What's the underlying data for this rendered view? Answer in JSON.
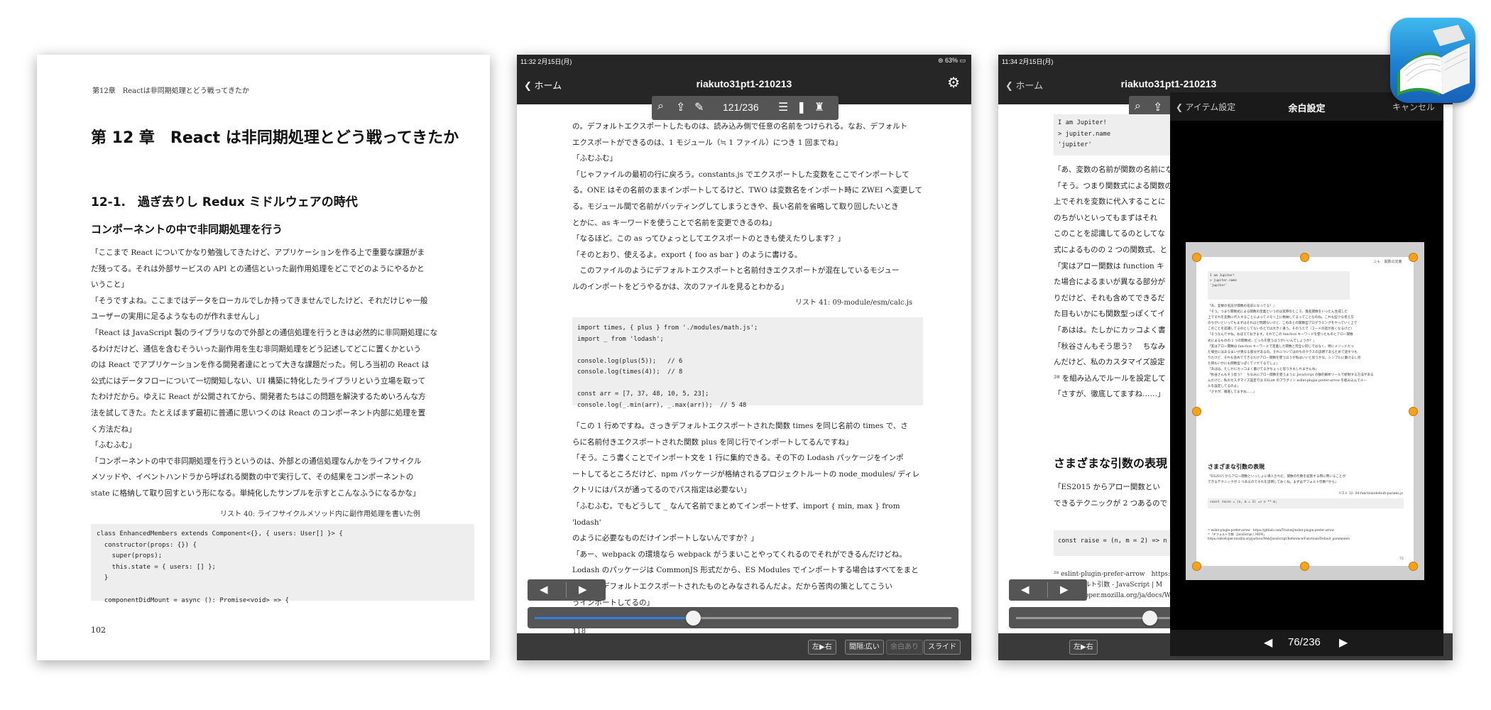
{
  "panel1": {
    "running_header": "第12章　Reactは非同期処理とどう戦ってきたか",
    "chapter_title": "第 12 章　React は非同期処理とどう戦ってきたか",
    "section_title": "12-1.　過ぎ去りし Redux ミドルウェアの時代",
    "subsection_title": "コンポーネントの中で非同期処理を行う",
    "paragraphs": [
      "「ここまで React についてかなり勉強してきたけど、アプリケーションを作る上で重要な課題がま",
      "だ残ってる。それは外部サービスの API との通信といった副作用処理をどこでどのようにやるかと",
      "いうこと」",
      "「そうですよね。ここまではデータをローカルでしか持ってきませんでしたけど、それだけじゃ一般",
      "ユーザーの実用に足るようなものが作れませんし」",
      "「React は JavaScript 製のライブラリなので外部との通信処理を行うときは必然的に非同期処理にな",
      "るわけだけど、通信を含むそういった副作用を生む非同期処理をどう記述してどこに置くかという",
      "のは React でアプリケーションを作る開発者達にとって大きな課題だった。何しろ当初の React は",
      "公式にはデータフローについて一切関知しない、UI 構築に特化したライブラリという立場を取って",
      "たわけだから。ゆえに React が公開されてから、開発者たちはこの問題を解決するためいろんな方",
      "法を試してきた。たとえばまず最初に普通に思いつくのは React のコンポーネント内部に処理を置",
      "く方法だね」",
      "「ふむふむ」",
      "「コンポーネントの中で非同期処理を行うというのは、外部との通信処理なんかをライフサイクル",
      "メソッドや、イベントハンドラから呼ばれる関数の中で実行して、その結果をコンポーネントの",
      "state に格納して取り回すという形になる。単純化したサンプルを示すとこんなふうになるかな」"
    ],
    "listing_caption": "リスト 40: ライフサイクルメソッド内に副作用処理を書いた例",
    "code": "class EnhancedMembers extends Component<{}, { users: User[] }> {\n  constructor(props: {}) {\n    super(props);\n    this.state = { users: [] };\n  }\n\n  componentDidMount = async (): Promise<void> => {",
    "page_number": "102"
  },
  "panel2": {
    "status_time": "11:32  2月15日(月)",
    "status_right": "⊜ 63% ▭",
    "nav_back": "ホーム",
    "nav_title": "riakuto31pt1-210213",
    "toolbar_page": "121/236",
    "paragraphs_top": [
      "の。デフォルトエクスポートしたものは、読み込み側で任意の名前をつけられる。なお、デフォルト",
      "エクスポートができるのは、1 モジュール（≒ 1 ファイル）につき 1 回までね」",
      "「ふむふむ」",
      "「じゃファイルの最初の行に戻ろう。constants.js でエクスポートした変数をここでインポートして",
      "る。ONE はその名前のままインポートしてるけど、TWO は変数名をインポート時に ZWEI へ変更して",
      "る。モジュール間で名前がバッティングしてしまうときや、長い名前を省略して取り回したいとき",
      "とかに、as キーワードを使うことで名前を変更できるのね」",
      "「なるほど。この as ってひょっとしてエクスポートのときも使えたりします？」",
      "「そのとおり、使えるよ。export { foo as bar } のように書ける。",
      "　このファイルのようにデフォルトエクスポートと名前付きエクスポートが混在しているモジュー",
      "ルのインポートをどうやるかは、次のファイルを見るとわかる」"
    ],
    "listing_caption": "リスト 41: 09-module/esm/calc.js",
    "code": "import times, { plus } from './modules/math.js';\nimport _ from 'lodash';\n\nconsole.log(plus(5));   // 6\nconsole.log(times(4));  // 8\n\nconst arr = [7, 37, 48, 10, 5, 23];\nconsole.log(_.min(arr), _.max(arr));  // 5 48",
    "paragraphs_bottom": [
      "「この 1 行めですね。さっきデフォルトエクスポートされた関数 times を同じ名前の times で、さ",
      "らに名前付きエクスポートされた関数 plus を同じ行でインポートしてるんですね」",
      "「そう。こう書くことでインポート文を 1 行に集約できる。その下の Lodash パッケージをインポ",
      "ートしてるところだけど、npm パッケージが格納されるプロジェクトルートの node_modules/ ディレ",
      "クトリにはパスが通ってるのでパス指定は必要ない」",
      "「ふむふむ。でもどうして _ なんて名前でまとめてインポートせず、import { min, max } from 'lodash'",
      "のように必要なものだけインポートしないんですか？」",
      "「あー、webpack の環境なら webpack がうまいことやってくれるのでそれができるんだけどね。",
      "Lodash のパッケージは CommonJS 形式だから、ES Modules でインポートする場合はすべてをまと",
      "めた形でデフォルトエクスポートされたものとみなされるんだよ。だから苦肉の策としてこうい",
      "うインポートしてるの」"
    ],
    "page_number": "118",
    "slider_progress": 0.38,
    "bottom_buttons": [
      "左▶右",
      "間隔:広い",
      "余白あり",
      "スライド"
    ]
  },
  "panel3": {
    "status_time": "11:34  2月15日(月)",
    "nav_back": "ホーム",
    "nav_title": "riakuto31pt1-210213",
    "code_top": "I am Jupiter!\n> jupiter.name\n'jupiter'",
    "paragraphs": [
      "「あ、変数の名前が関数の名前になってる！」",
      "「そう。つまり関数式による関数の",
      "上でそれを変数に代入することに",
      "のちがいといってもまずはそれ",
      "このことを認識してるのとしてな",
      "式によるものの 2 つの関数式、と",
      "「実はアロー関数は function キ",
      "た場合によるまいが異なる部分が",
      "りだけど、それも含めてできるだ",
      "た目もいかにも関数型っぽくてイ",
      "「あはは。たしかにカッコよく書",
      "「秋谷さんもそう思う？　ちなみ",
      "んだけど、私のカスタマイズ設定",
      "²⁸ を組み込んでルールを設定して",
      "「さすが、徹底してますね……」"
    ],
    "heading": "さまざまな引数の表現",
    "paragraphs2": [
      "「ES2015 からアロー関数とい",
      "できるテクニックが 2 つあるので"
    ],
    "code_b": "const raise = (n, m = 2) => n ** m;",
    "footnotes": [
      "²⁸ eslint-plugin-prefer-arrow　https://",
      "²⁹「デフォルト引数 - JavaScript | M",
      "ps://developer.mozilla.org/ja/docs/We"
    ],
    "slider_progress": 0.32,
    "overlay": {
      "back": "アイテム設定",
      "title": "余白設定",
      "cancel": "キャンセル",
      "page": "76/236",
      "mini_header": "2-4.　関数の定義",
      "mini_code": "I am Jupiter!\n> jupiter.name\n'jupiter'",
      "mini_lines": [
        "「あ、変数の名前が関数の名前になってる！」",
        "「そう。つまり関数式による関数の定義というのは実際のところ、無名関数をいったん生成した",
        "上でそれを変数に代入することによってメモリ上に格納してるってことなのね。これも些少な考え方",
        "のちがいといってもまずはそれほど問題ないけど、このあとの関数型プログラミングをやっていく上で",
        "このことを認識してるのとしてないのとでは大きく違う。そのうえで（コードの話が長くなるけど）",
        "「そうなんですね。おぼえておきます。それでこの function キーワードを使ったものとアロー関数",
        "式によるものの 2 つの関数式、どっちを使うほうがいいんでしょうか？」",
        "「実はアロー関数は function キーワードで定義した関数と完全に同じではなく、特にメソッドだっ",
        "た場合にはあるまいが異なる部分があるの。それについてはのちのクラスの説明であらためて話すつも",
        "りだけど、それも含めてできるだけアロー関数を使うほうが私はいいと思うかな。シンプルに書けるし見",
        "た目もいかにも関数型っぽくてイケてるでしょ」",
        "「あはは。たしかにカッコよく書けてるかちょっと思うかもしれませんね」",
        "「秋谷さんもそう思う？　ちなみにアロー関数を使うように JavaScript の静的解析ツールで統制する方法がある",
        "んだけど、私のカスタマイズ設定では ESLint のプラグイン eslint-plugin-prefer-arrow を組み込んでルー",
        "ルを設定してるのよ」",
        "「さすが、徹底してますね……」"
      ],
      "mini_heading": "さまざまな引数の表現",
      "mini_lines2": [
        "「ES2015 からアロー関数といっしょに導入された、関数の引数を拡張する際に用いることが",
        "できるテクニックが 2 つあるのでそれを説明しておくね。まずはデフォルト引数²⁹から」"
      ],
      "mini_caption": "リスト 32: 04-function/default-params.js",
      "mini_codeb": "const raise = (n, m = 2) => n ** m;",
      "mini_footnotes": [
        "²⁸ eslint-plugin-prefer-arrow　https://github.com/TristonJ/eslint-plugin-prefer-arrow",
        "²⁹「デフォルト引数 - JavaScript | MDN」",
        "https://developer.mozilla.org/ja/docs/Web/JavaScript/Reference/Functions/Default_parameters"
      ],
      "mini_page": "73"
    },
    "bottom_buttons": [
      "左▶右"
    ]
  },
  "app_icon": {
    "name": "book-reader-app-icon",
    "colors": [
      "#3fb9ee",
      "#1762b8"
    ]
  },
  "colors": {
    "accent": "#2f7fe8",
    "bar": "#262626",
    "handle": "#f6a21d"
  }
}
